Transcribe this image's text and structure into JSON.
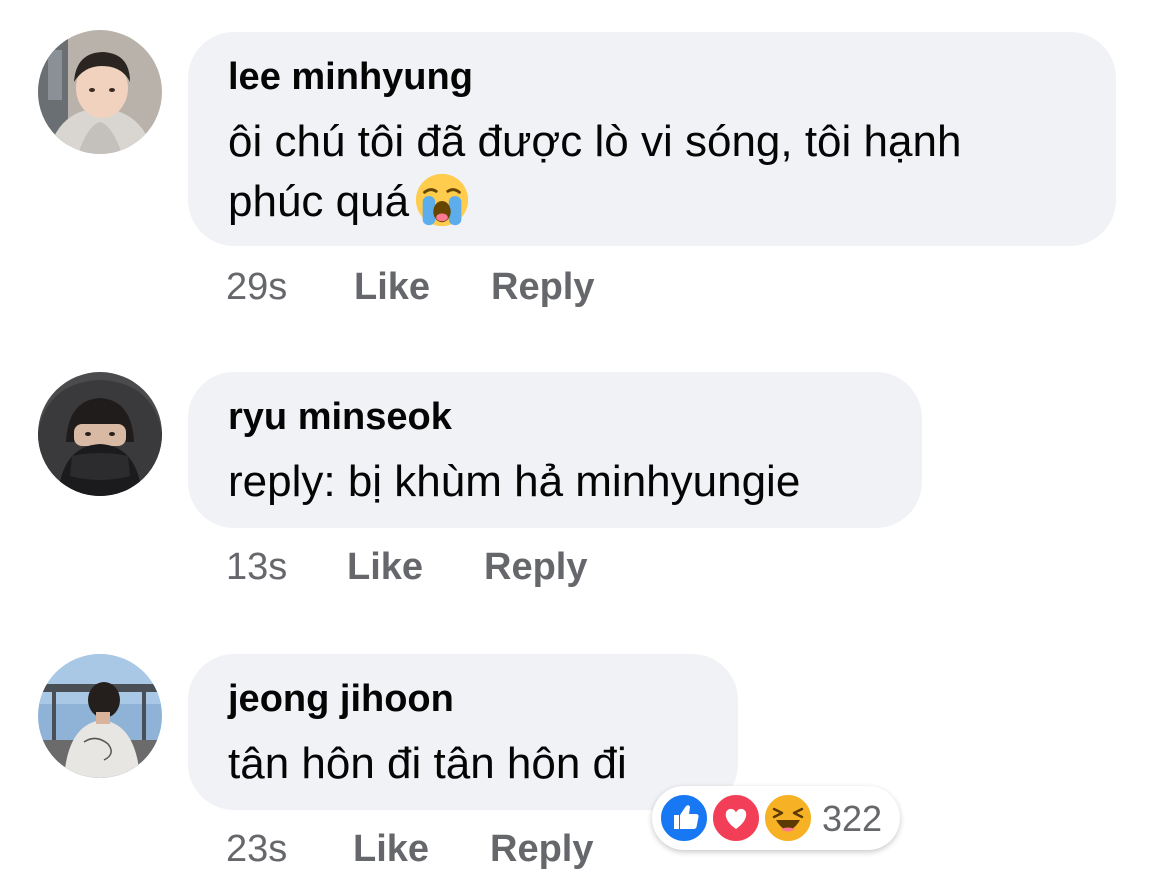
{
  "comments": [
    {
      "author": "lee minhyung",
      "text": "ôi chú tôi đã được lò vi sóng, tôi hạnh",
      "text_line2": "phúc quá",
      "emoji": "loudly-crying-face-icon",
      "time": "29s",
      "like_label": "Like",
      "reply_label": "Reply"
    },
    {
      "author": "ryu minseok",
      "text": "reply: bị khùm hả minhyungie",
      "time": "13s",
      "like_label": "Like",
      "reply_label": "Reply"
    },
    {
      "author": "jeong jihoon",
      "text": "tân hôn đi tân hôn đi",
      "time": "23s",
      "like_label": "Like",
      "reply_label": "Reply",
      "reactions": {
        "icons": [
          "like-reaction-icon",
          "love-reaction-icon",
          "haha-reaction-icon"
        ],
        "count": "322"
      }
    }
  ],
  "colors": {
    "bubble_bg": "#f0f2f5",
    "text": "#050505",
    "meta": "#65676b",
    "like_blue": "#1877f2",
    "love_red": "#f33e58",
    "haha_yellow": "#f7b125"
  }
}
